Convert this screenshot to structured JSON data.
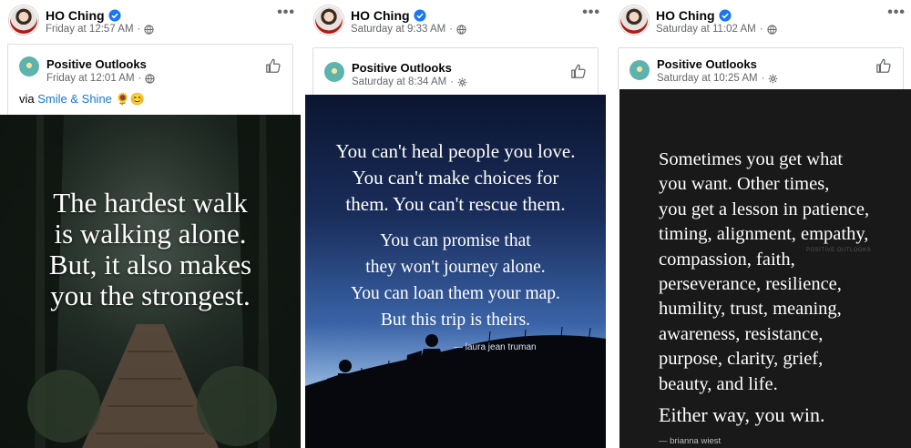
{
  "posts": [
    {
      "author": "HO Ching",
      "time": "Friday at 12:57 AM",
      "shared_page": "Positive Outlooks",
      "shared_time": "Friday at 12:01 AM",
      "via_prefix": "via",
      "via_link": "Smile & Shine",
      "via_emoji": "🌻😊",
      "quote": "The hardest walk\nis walking alone.\nBut, it also makes\nyou the strongest."
    },
    {
      "author": "HO Ching",
      "time": "Saturday at 9:33 AM",
      "shared_page": "Positive Outlooks",
      "shared_time": "Saturday at 8:34 AM",
      "quote_a": "You can't heal people you love.\nYou can't make choices for\nthem. You can't rescue them.",
      "quote_b": "You can promise that\nthey won't journey alone.\nYou can loan them your map.\nBut this trip is theirs.",
      "attribution": "— laura jean truman"
    },
    {
      "author": "HO Ching",
      "time": "Saturday at 11:02 AM",
      "shared_page": "Positive Outlooks",
      "shared_time": "Saturday at 10:25 AM",
      "quote": "Sometimes you get what\nyou want. Other times,\nyou get a lesson in patience,\ntiming, alignment, empathy,\ncompassion, faith,\nperseverance, resilience,\nhumility, trust, meaning,\nawareness, resistance,\npurpose, clarity, grief,\nbeauty, and life.",
      "quote_end": "Either way, you win.",
      "attribution": "— brianna wiest",
      "watermark": "POSITIVE OUTLOOKS"
    }
  ],
  "icons": {
    "verified": "verified-badge-icon",
    "audience": "globe-icon",
    "shared_audience": "gear-icon",
    "like": "thumbs-up-icon",
    "more": "more-options-icon"
  },
  "more_glyph": "•••",
  "colors": {
    "verified": "#1877f2",
    "link": "#1876d2",
    "meta": "#65676b"
  }
}
